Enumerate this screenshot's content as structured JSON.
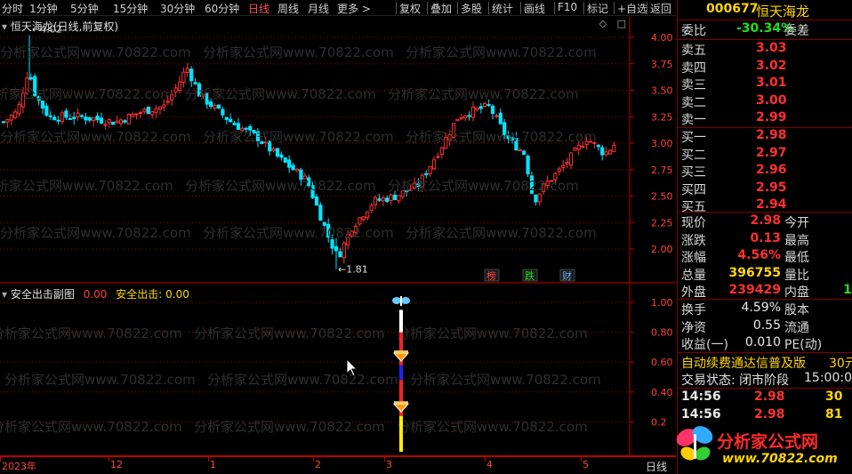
{
  "toolbar": {
    "left_items": [
      "分时",
      "1分钟",
      "5分钟",
      "15分钟",
      "30分钟",
      "60分钟",
      "日线",
      "周线",
      "月线",
      "更多 >"
    ],
    "active": "日线",
    "right_items": [
      "复权",
      "叠加",
      "多股",
      "统计",
      "画线",
      "F10",
      "标记",
      "+自选",
      "返回"
    ]
  },
  "main_chart": {
    "title": "恒天海龙(日线,前复权)",
    "high_label": "4.02",
    "low_label": "1.81",
    "y_ticks": [
      "4.00",
      "3.75",
      "3.50",
      "3.25",
      "3.00",
      "2.75",
      "2.50",
      "2.25",
      "2.00"
    ],
    "badges": [
      {
        "text": "榜",
        "color": "#ff4040"
      },
      {
        "text": "跌",
        "color": "#22dd22"
      },
      {
        "text": "财",
        "color": "#66aaff"
      }
    ],
    "watermark": "分析家公式网www.70822.com"
  },
  "sub_chart": {
    "title": "安全出击副图",
    "title_value": "0.00",
    "series_label": "安全出击:",
    "series_value": "0.00",
    "y_ticks": [
      "1.00",
      "0.80",
      "0.60",
      "0.40",
      "0.2"
    ]
  },
  "x_axis": {
    "labels": [
      "2023年",
      "12",
      "1",
      "2",
      "3",
      "4",
      "5"
    ],
    "period": "日线"
  },
  "quote": {
    "code": "000677",
    "name": "恒天海龙",
    "weibi_label": "委比",
    "weibi": "-30.34%",
    "weicha_label": "委差",
    "asks": [
      {
        "label": "卖五",
        "price": "3.03"
      },
      {
        "label": "卖四",
        "price": "3.02"
      },
      {
        "label": "卖三",
        "price": "3.01"
      },
      {
        "label": "卖二",
        "price": "3.00"
      },
      {
        "label": "卖一",
        "price": "2.99"
      }
    ],
    "bids": [
      {
        "label": "买一",
        "price": "2.98"
      },
      {
        "label": "买二",
        "price": "2.97"
      },
      {
        "label": "买三",
        "price": "2.96"
      },
      {
        "label": "买四",
        "price": "2.95"
      },
      {
        "label": "买五",
        "price": "2.94"
      }
    ],
    "stats": [
      {
        "l": "现价",
        "v": "2.98",
        "c": "red",
        "r": "今开"
      },
      {
        "l": "涨跌",
        "v": "0.13",
        "c": "red",
        "r": "最高"
      },
      {
        "l": "涨幅",
        "v": "4.56%",
        "c": "red",
        "r": "最低"
      },
      {
        "l": "总量",
        "v": "396755",
        "c": "yellow",
        "r": "量比"
      },
      {
        "l": "外盘",
        "v": "239429",
        "c": "red",
        "r": "内盘",
        "extra": "1"
      }
    ],
    "stats2": [
      {
        "l": "换手",
        "v": "4.59%",
        "r": "股本"
      },
      {
        "l": "净资",
        "v": "0.55",
        "r": "流通"
      },
      {
        "l": "收益(一)",
        "v": "0.010",
        "r": "PE(动)"
      }
    ],
    "marquee": "自动续费通达信普及版",
    "marquee_tail": "30元",
    "status": "交易状态: 闭市阶段",
    "status_time": "15:00:0",
    "ticks": [
      {
        "time": "14:56",
        "price": "2.98",
        "vol": "30"
      },
      {
        "time": "14:56",
        "price": "2.98",
        "vol": "81"
      }
    ],
    "logo_text": "分析家公式网",
    "logo_url": "www.70822.com"
  },
  "colors": {
    "up": "#ff3030",
    "down": "#00e5ff",
    "grid": "#a00000",
    "axis": "#c00000"
  }
}
